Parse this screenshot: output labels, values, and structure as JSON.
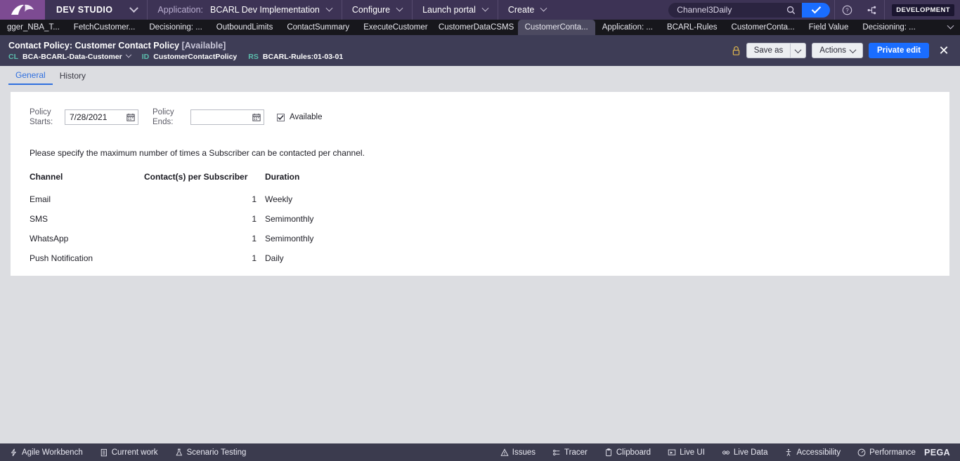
{
  "appbar": {
    "logo_name": "pega-logo",
    "studio_label": "DEV STUDIO",
    "application_key": "Application:",
    "application_value": "BCARL Dev Implementation",
    "configure_label": "Configure",
    "launch_portal_label": "Launch portal",
    "create_label": "Create",
    "search_value": "Channel3Daily",
    "search_placeholder": "Search",
    "env_badge": "DEVELOPMENT",
    "accent_blue": "#1a6dff",
    "bar_purple": "#3d3355",
    "logo_purple": "#7d4b92"
  },
  "tabstrip": {
    "tabs": [
      {
        "label": "gger_NBA_T...",
        "active": false
      },
      {
        "label": "FetchCustomer...",
        "active": false
      },
      {
        "label": "Decisioning: ...",
        "active": false
      },
      {
        "label": "OutboundLimits",
        "active": false
      },
      {
        "label": "ContactSummary",
        "active": false
      },
      {
        "label": "ExecuteCustomer",
        "active": false
      },
      {
        "label": "CustomerDataCSMS",
        "active": false
      },
      {
        "label": "CustomerConta...",
        "active": true
      },
      {
        "label": "Application: ...",
        "active": false
      },
      {
        "label": "BCARL-Rules",
        "active": false
      },
      {
        "label": "CustomerConta...",
        "active": false
      },
      {
        "label": "Field Value",
        "active": false
      },
      {
        "label": "Decisioning: ...",
        "active": false
      }
    ]
  },
  "ruleheader": {
    "title": "Contact Policy: Customer Contact Policy",
    "status": "[Available]",
    "class_key": "CL",
    "class_value": "BCA-BCARL-Data-Customer",
    "id_key": "ID",
    "id_value": "CustomerContactPolicy",
    "ruleset_key": "RS",
    "ruleset_value": "BCARL-Rules:01-03-01",
    "save_as_label": "Save as",
    "actions_label": "Actions",
    "private_edit_label": "Private edit",
    "close_label": "✕"
  },
  "subtabs": [
    {
      "label": "General",
      "active": true
    },
    {
      "label": "History",
      "active": false
    }
  ],
  "form": {
    "policy_starts_label": "Policy Starts:",
    "policy_starts_line1": "Policy",
    "policy_starts_line2": "Starts:",
    "policy_starts_value": "7/28/2021",
    "policy_ends_line1": "Policy",
    "policy_ends_line2": "Ends:",
    "policy_ends_value": "",
    "policy_ends_placeholder": "",
    "available_label": "Available",
    "available_checked": true,
    "help_text": "Please specify the maximum number of times a Subscriber can be contacted per channel."
  },
  "table": {
    "headers": [
      "Channel",
      "Contact(s) per Subscriber",
      "Duration"
    ],
    "rows": [
      {
        "channel": "Email",
        "contacts": "1",
        "duration": "Weekly"
      },
      {
        "channel": "SMS",
        "contacts": "1",
        "duration": "Semimonthly"
      },
      {
        "channel": "WhatsApp",
        "contacts": "1",
        "duration": "Semimonthly"
      },
      {
        "channel": "Push Notification",
        "contacts": "1",
        "duration": "Daily"
      }
    ]
  },
  "footer": {
    "left_items": [
      {
        "label": "Agile Workbench",
        "icon": "lightning-icon"
      },
      {
        "label": "Current work",
        "icon": "clipboard-list-icon"
      },
      {
        "label": "Scenario Testing",
        "icon": "flask-icon"
      }
    ],
    "right_items": [
      {
        "label": "Issues",
        "icon": "warning-triangle-icon"
      },
      {
        "label": "Tracer",
        "icon": "tracer-icon"
      },
      {
        "label": "Clipboard",
        "icon": "clipboard-icon"
      },
      {
        "label": "Live UI",
        "icon": "live-ui-icon"
      },
      {
        "label": "Live Data",
        "icon": "live-data-icon"
      },
      {
        "label": "Accessibility",
        "icon": "accessibility-icon"
      },
      {
        "label": "Performance",
        "icon": "performance-icon"
      }
    ],
    "brand": "PEGA"
  }
}
